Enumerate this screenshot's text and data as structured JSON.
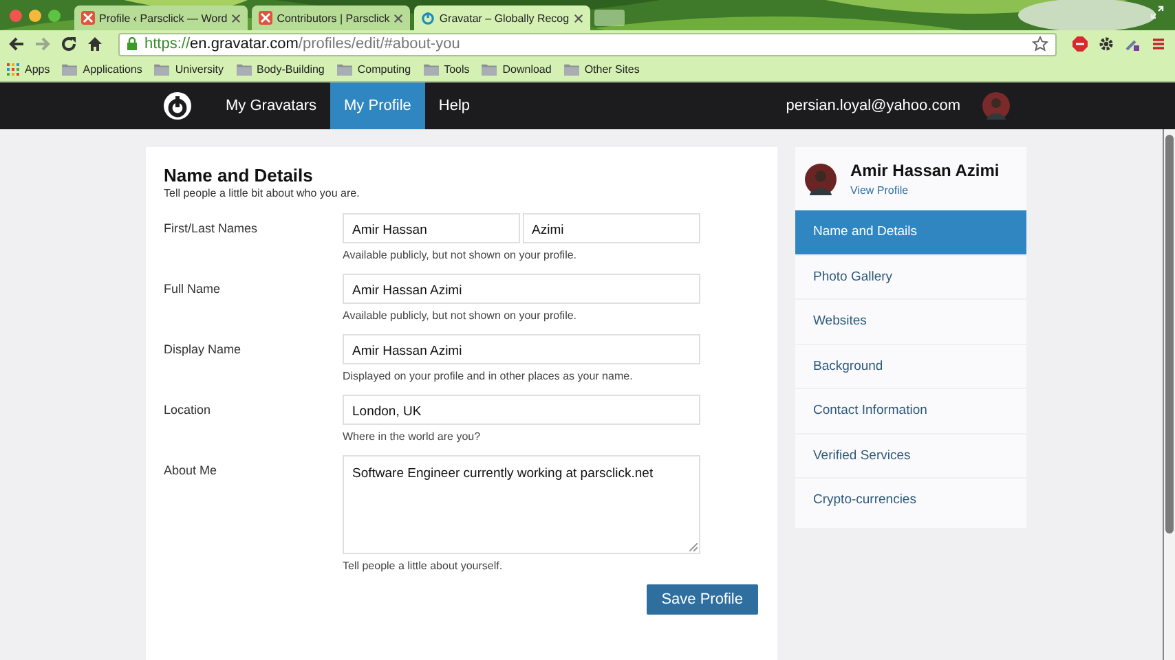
{
  "browser": {
    "tabs": [
      {
        "title": "Profile ‹ Parsclick — Word",
        "selected": false,
        "kind": "site"
      },
      {
        "title": "Contributors | Parsclick",
        "selected": false,
        "kind": "site"
      },
      {
        "title": "Gravatar – Globally Recog",
        "selected": true,
        "kind": "gravatar"
      }
    ],
    "address": {
      "scheme": "https://",
      "host": "en.gravatar.com",
      "path": "/profiles/edit/#about-you"
    },
    "bookmarks": [
      {
        "label": "Apps",
        "kind": "apps"
      },
      {
        "label": "Applications",
        "kind": "folder"
      },
      {
        "label": "University",
        "kind": "folder"
      },
      {
        "label": "Body-Building",
        "kind": "folder"
      },
      {
        "label": "Computing",
        "kind": "folder"
      },
      {
        "label": "Tools",
        "kind": "folder"
      },
      {
        "label": "Download",
        "kind": "folder"
      },
      {
        "label": "Other Sites",
        "kind": "folder"
      }
    ]
  },
  "nav": {
    "items": [
      {
        "label": "My Gravatars",
        "selected": false
      },
      {
        "label": "My Profile",
        "selected": true
      },
      {
        "label": "Help",
        "selected": false
      }
    ],
    "email": "persian.loyal@yahoo.com"
  },
  "form": {
    "title": "Name and Details",
    "subtitle": "Tell people a little bit about who you are.",
    "fields": [
      {
        "label": "First/Last Names",
        "kind": "pair",
        "values": [
          "Amir Hassan",
          "Azimi"
        ],
        "help": "Available publicly, but not shown on your profile."
      },
      {
        "label": "Full Name",
        "kind": "text",
        "values": [
          "Amir Hassan Azimi"
        ],
        "help": "Available publicly, but not shown on your profile."
      },
      {
        "label": "Display Name",
        "kind": "text",
        "values": [
          "Amir Hassan Azimi"
        ],
        "help": "Displayed on your profile and in other places as your name."
      },
      {
        "label": "Location",
        "kind": "text",
        "values": [
          "London, UK"
        ],
        "help": "Where in the world are you?"
      },
      {
        "label": "About Me",
        "kind": "textarea",
        "values": [
          "Software Engineer currently working at parsclick.net"
        ],
        "help": "Tell people a little about yourself."
      }
    ],
    "save": "Save Profile"
  },
  "sidebar": {
    "name": "Amir Hassan Azimi",
    "link": "View Profile",
    "items": [
      {
        "label": "Name and Details",
        "selected": true
      },
      {
        "label": "Photo Gallery",
        "selected": false
      },
      {
        "label": "Websites",
        "selected": false
      },
      {
        "label": "Background",
        "selected": false
      },
      {
        "label": "Contact Information",
        "selected": false
      },
      {
        "label": "Verified Services",
        "selected": false
      },
      {
        "label": "Crypto-currencies",
        "selected": false
      }
    ]
  }
}
